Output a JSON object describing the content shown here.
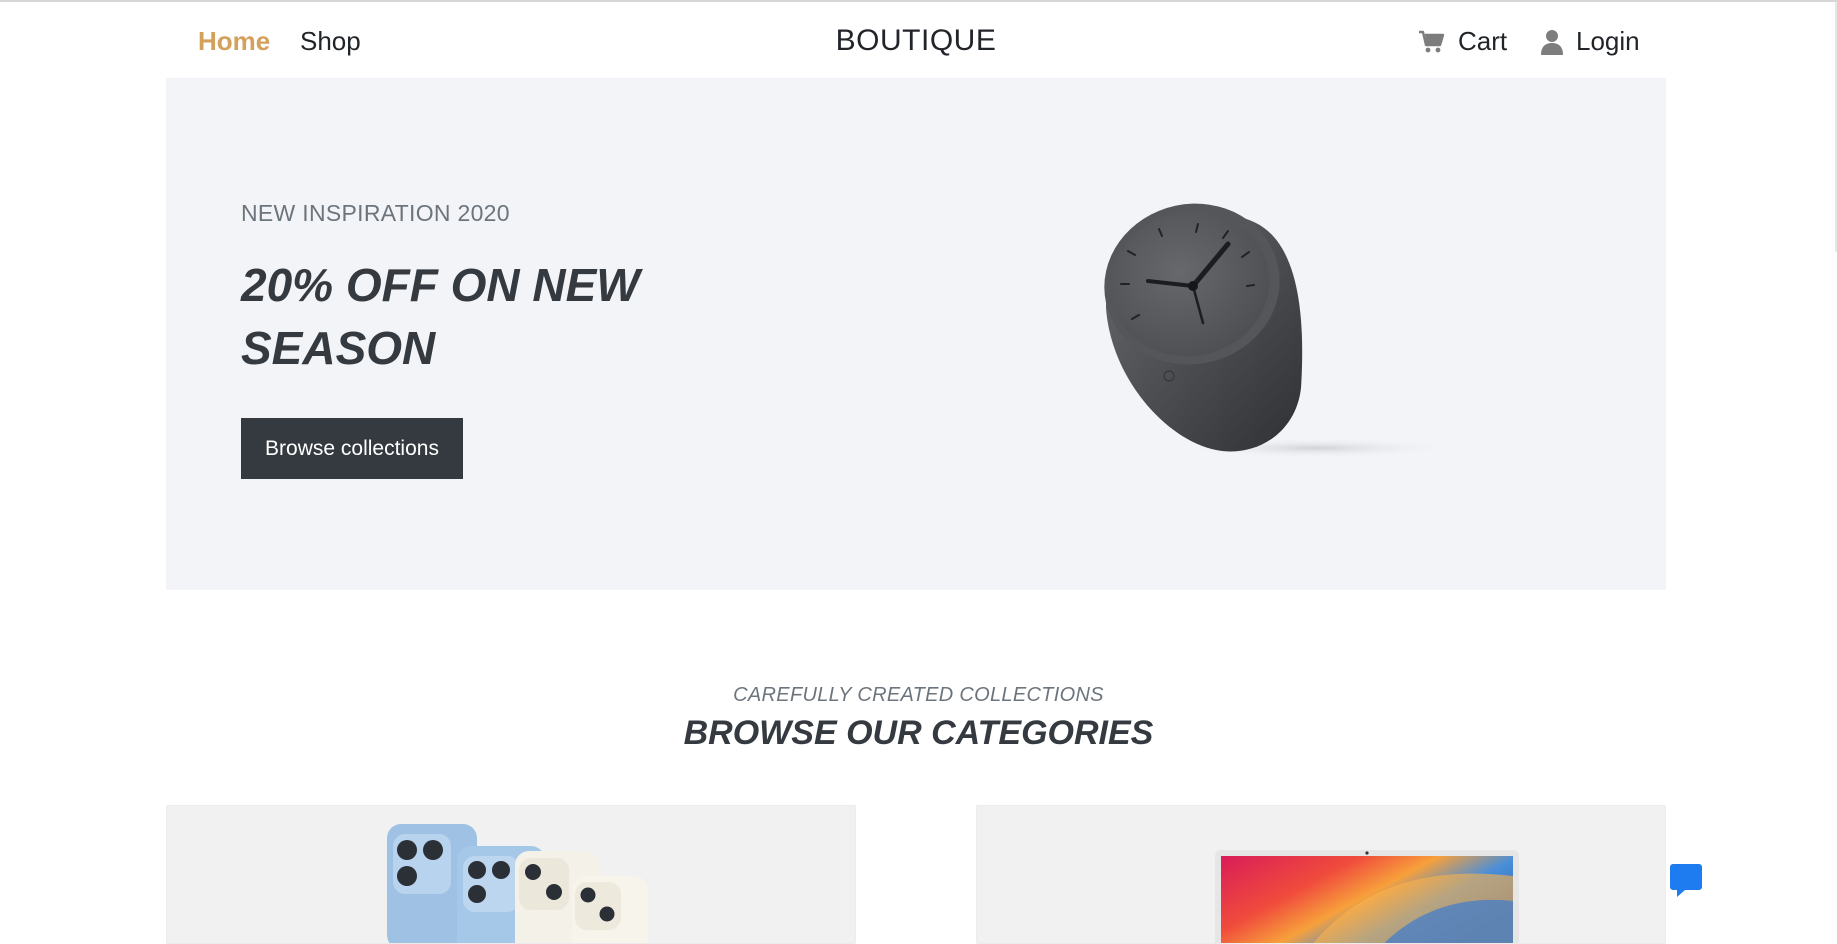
{
  "nav": {
    "home": "Home",
    "shop": "Shop",
    "brand": "BOUTIQUE",
    "cart": "Cart",
    "login": "Login",
    "active_color": "#d4a15c"
  },
  "hero": {
    "eyebrow": "NEW INSPIRATION 2020",
    "title": "20% OFF ON NEW SEASON",
    "button": "Browse collections",
    "image_icon": "desk-clock-image"
  },
  "categories": {
    "eyebrow": "CAREFULLY CREATED COLLECTIONS",
    "title": "BROWSE OUR CATEGORIES",
    "cards": [
      {
        "image_icon": "iphones-image"
      },
      {
        "image_icon": "macbook-image"
      }
    ]
  },
  "chat": {
    "icon": "chat-bubble-icon",
    "color": "#1e7bf0"
  }
}
